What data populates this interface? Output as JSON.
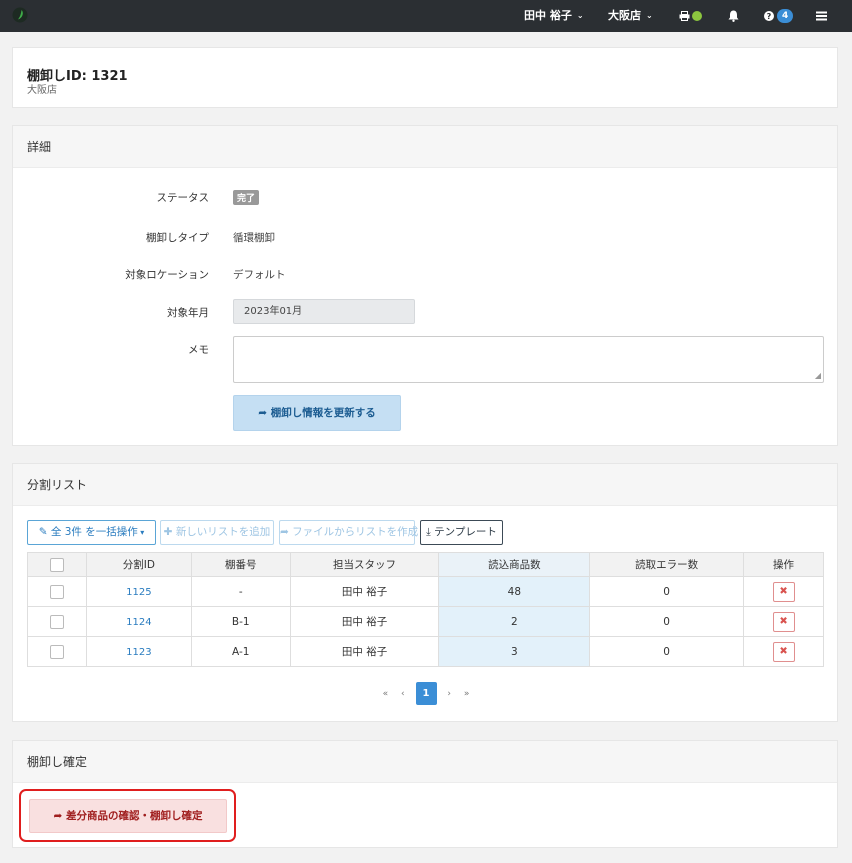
{
  "topbar": {
    "user": "田中 裕子",
    "store": "大阪店",
    "help_count": "4"
  },
  "header": {
    "title": "棚卸しID: 1321",
    "store": "大阪店"
  },
  "details": {
    "section_title": "詳細",
    "status_label": "ステータス",
    "status_value": "完了",
    "type_label": "棚卸しタイプ",
    "type_value": "循環棚卸",
    "location_label": "対象ロケーション",
    "location_value": "デフォルト",
    "month_label": "対象年月",
    "month_value": "2023年01月",
    "memo_label": "メモ",
    "memo_value": "",
    "update_button": "棚卸し情報を更新する"
  },
  "split_list": {
    "section_title": "分割リスト",
    "bulk_button": "全 3件 を一括操作",
    "add_button": "新しいリストを追加",
    "file_button": "ファイルからリストを作成",
    "template_button": "テンプレート",
    "columns": [
      "分割ID",
      "棚番号",
      "担当スタッフ",
      "読込商品数",
      "読取エラー数",
      "操作"
    ],
    "rows": [
      {
        "id": "1125",
        "shelf": "-",
        "staff": "田中 裕子",
        "read_count": "48",
        "error_count": "0"
      },
      {
        "id": "1124",
        "shelf": "B-1",
        "staff": "田中 裕子",
        "read_count": "2",
        "error_count": "0"
      },
      {
        "id": "1123",
        "shelf": "A-1",
        "staff": "田中 裕子",
        "read_count": "3",
        "error_count": "0"
      }
    ],
    "pager": {
      "first": "«",
      "prev": "‹",
      "current": "1",
      "next": "›",
      "last": "»"
    }
  },
  "confirm": {
    "section_title": "棚卸し確定",
    "button": "差分商品の確認・棚卸し確定"
  }
}
